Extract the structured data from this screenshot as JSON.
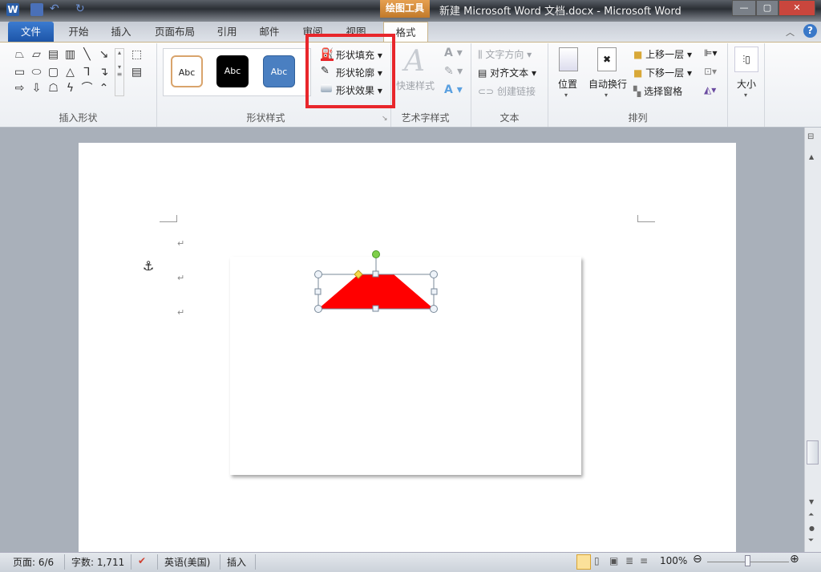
{
  "title_bar": {
    "context_tool": "绘图工具",
    "title": "新建 Microsoft Word 文档.docx - Microsoft Word"
  },
  "tabs": [
    {
      "label": "文件"
    },
    {
      "label": "开始"
    },
    {
      "label": "插入"
    },
    {
      "label": "页面布局"
    },
    {
      "label": "引用"
    },
    {
      "label": "邮件"
    },
    {
      "label": "审阅"
    },
    {
      "label": "视图"
    },
    {
      "label": "格式"
    }
  ],
  "ribbon": {
    "insert_shapes": {
      "label": "插入形状"
    },
    "shape_styles": {
      "label": "形状样式",
      "style_samples": [
        "Abc",
        "Abc",
        "Abc"
      ],
      "fill": "形状填充",
      "outline": "形状轮廓",
      "effects": "形状效果"
    },
    "wordart": {
      "label": "艺术字样式",
      "quick_styles": "快速样式"
    },
    "text": {
      "label": "文本",
      "direction": "文字方向",
      "align": "对齐文本",
      "link": "创建链接"
    },
    "arrange": {
      "label": "排列",
      "position": "位置",
      "wrap": "自动换行",
      "bring_forward": "上移一层",
      "send_backward": "下移一层",
      "selection_pane": "选择窗格"
    },
    "size": {
      "label": "大小"
    }
  },
  "document": {
    "paragraph_mark": "↵",
    "anchor": "⚓"
  },
  "status_bar": {
    "page": "页面: 6/6",
    "words": "字数: 1,711",
    "language": "英语(美国)",
    "mode": "插入",
    "zoom": "100%"
  },
  "colors": {
    "shape_fill": "#ff0000",
    "highlight": "#e8262b",
    "file_tab": "#1d55a8"
  }
}
